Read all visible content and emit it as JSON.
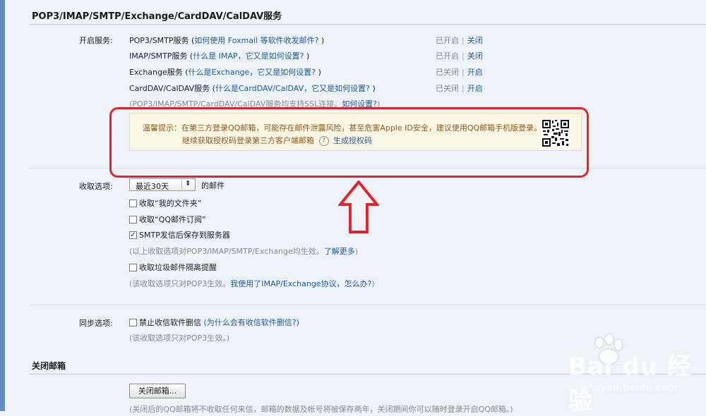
{
  "services_section": {
    "title": "POP3/IMAP/SMTP/Exchange/CardDAV/CalDAV服务",
    "enable_label": "开启服务:",
    "services": [
      {
        "name": "POP3/SMTP服务",
        "help_link": "如何使用 Foxmail 等软件收发邮件?",
        "status": "已开启",
        "action": "关闭"
      },
      {
        "name": "IMAP/SMTP服务",
        "help_link": "什么是 IMAP，它又是如何设置?",
        "status": "已开启",
        "action": "关闭"
      },
      {
        "name": "Exchange服务",
        "help_link": "什么是Exchange，它又是如何设置?",
        "status": "已关闭",
        "action": "开启"
      },
      {
        "name": "CardDAV/CalDAV服务",
        "help_link": "什么是CardDAV/CalDAV，它又是如何设置?",
        "status": "已关闭",
        "action": "开启"
      }
    ],
    "ssl_note": "(POP3/IMAP/SMTP/CardDAV/CalDAV服务均支持SSL连接。",
    "ssl_link": "如何设置?",
    "ssl_close": ")"
  },
  "notice": {
    "line1": "温馨提示：在第三方登录QQ邮箱，可能存在邮件泄露风险，甚至危害Apple ID安全，建议使用QQ邮箱手机版登录。",
    "line2": "继续获取授权码登录第三方客户端邮箱",
    "help_icon": "?",
    "generate_link": "生成授权码"
  },
  "fetch_options": {
    "label": "收取选项:",
    "range_value": "最近30天",
    "range_suffix": "的邮件",
    "options": [
      {
        "label": "收取“我的文件夹”",
        "checked": false
      },
      {
        "label": "收取“QQ邮件订阅”",
        "checked": false
      },
      {
        "label": "SMTP发信后保存到服务器",
        "checked": true
      }
    ],
    "note1": "(以上收取选项对POP3/IMAP/SMTP/Exchange均生效。",
    "note1_link": "了解更多",
    "note1_close": ")",
    "spam_option": "收取垃圾邮件隔离提醒",
    "note2": "(该收取选项只对POP3生效。",
    "note2_link": "我使用了IMAP/Exchange协议，怎么办?",
    "note2_close": ")"
  },
  "sync_options": {
    "label": "同步选项:",
    "option": "禁止收信软件删信",
    "option_link": "(为什么会有收信软件删信?)",
    "note": "(该收取选项只对POP3生效。)"
  },
  "close_mailbox": {
    "title": "关闭邮箱",
    "button": "关闭邮箱...",
    "note": "(关闭后的QQ邮箱将不收取任何来信，邮箱的数据及帐号将被保存两年，关闭期间你可以随时登录开启QQ邮箱。)"
  },
  "watermark": {
    "brand": "Bai du 经验",
    "url": "jingyan.baidu.com"
  },
  "colors": {
    "link": "#1d5a9f",
    "highlight_border": "#e3252b",
    "notice_bg": "#fbf7e5",
    "notice_text": "#8a5a1f"
  }
}
